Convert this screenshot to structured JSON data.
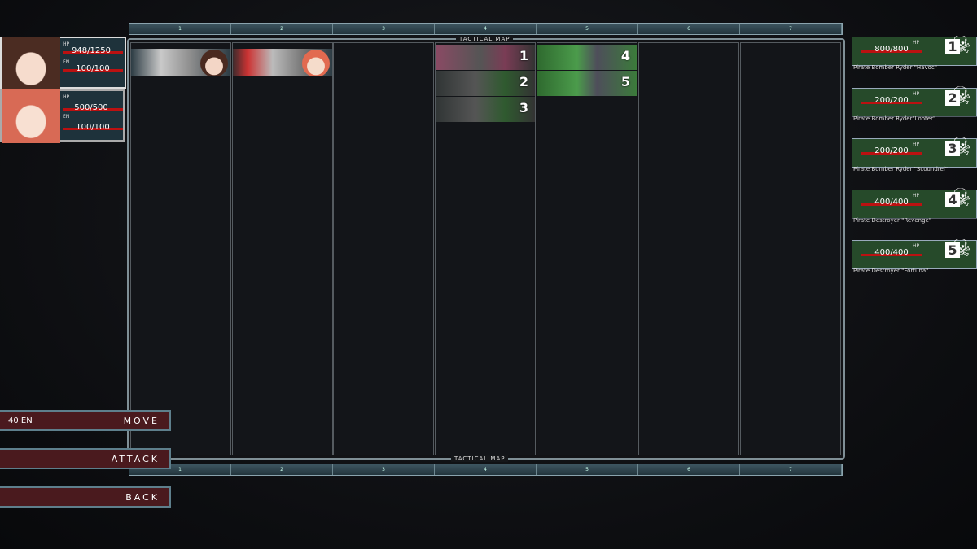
{
  "map": {
    "title": "TACTICAL MAP",
    "columns": [
      "1",
      "2",
      "3",
      "4",
      "5",
      "6",
      "7"
    ]
  },
  "party": [
    {
      "hp_label": "HP",
      "hp": "948/1250",
      "hp_fraction": 0.758,
      "en_label": "EN",
      "en": "100/100",
      "en_fraction": 1.0
    },
    {
      "hp_label": "HP",
      "hp": "500/500",
      "hp_fraction": 1.0,
      "en_label": "EN",
      "en": "100/100",
      "en_fraction": 1.0
    }
  ],
  "enemies": [
    {
      "number": "1",
      "hp_label": "HP",
      "hp": "800/800",
      "name": "Pirate Bomber Ryder \"Havoc\""
    },
    {
      "number": "2",
      "hp_label": "HP",
      "hp": "200/200",
      "name": "Pirate Bomber Ryder\"Looter\""
    },
    {
      "number": "3",
      "hp_label": "HP",
      "hp": "200/200",
      "name": "Pirate Bomber Ryder \"Scoundrel\""
    },
    {
      "number": "4",
      "hp_label": "HP",
      "hp": "400/400",
      "name": "Pirate Destroyer \"Revenge\""
    },
    {
      "number": "5",
      "hp_label": "HP",
      "hp": "400/400",
      "name": "Pirate Destroyer \"Fortuna\""
    }
  ],
  "actions": {
    "move": "MOVE",
    "move_cost": "40 EN",
    "attack": "ATTACK",
    "back": "BACK"
  },
  "colors": {
    "ally_panel": "#1e323b",
    "enemy_panel": "#264a2a",
    "button": "#4a1a1e",
    "bar": "#bb1111"
  }
}
